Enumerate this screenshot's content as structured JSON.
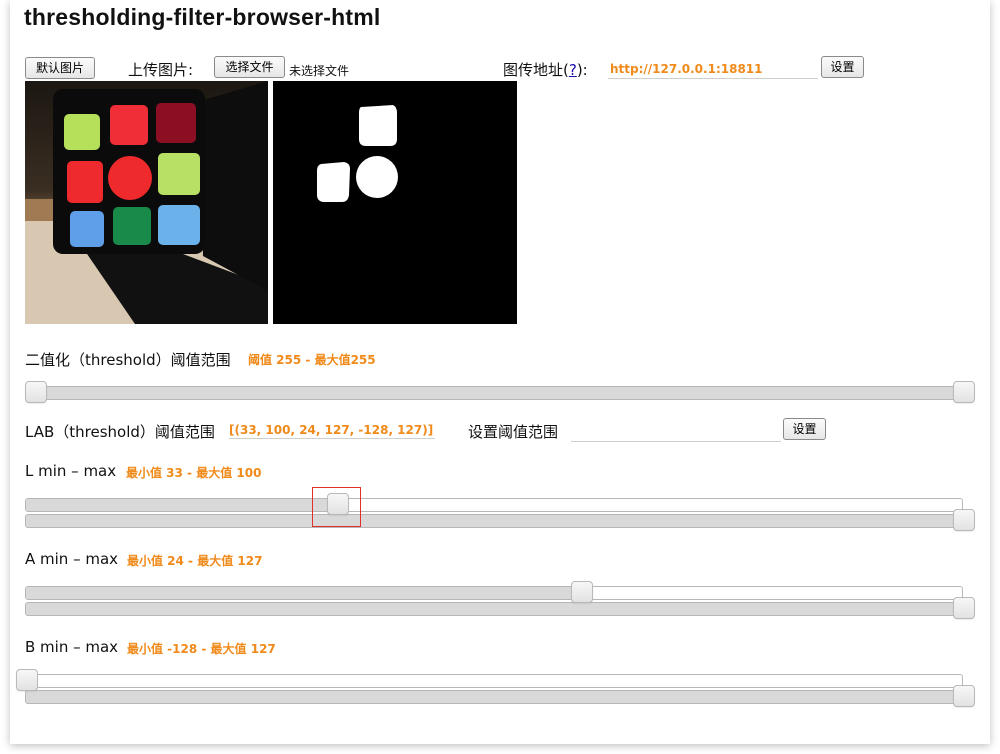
{
  "header": {
    "title": "thresholding-filter-browser-html"
  },
  "controls": {
    "default_image_label": "默认图片",
    "upload_label": "上传图片:",
    "choose_file_label": "选择文件",
    "no_file_label": "未选择文件",
    "image_url_label_prefix": "图传地址(",
    "image_url_help": "?",
    "image_url_label_suffix": "):",
    "image_url_value": "http://127.0.0.1:18811",
    "set_label": "设置"
  },
  "images": {
    "source": "rubiks-cube-photo",
    "mask": "binary-threshold-mask"
  },
  "binary": {
    "label": "二值化（threshold）阈值范围",
    "value_text": "阈值 255 - 最大值255",
    "min": 0,
    "max": 255,
    "range_min": 0,
    "range_max": 255
  },
  "lab": {
    "label": "LAB（threshold）阈值范围",
    "value_text": "[(33, 100, 24, 127, -128, 127)]",
    "set_range_label": "设置阈值范围",
    "set_range_value": "",
    "set_label": "设置"
  },
  "l_slider": {
    "label": "L min – max",
    "value_text": "最小值 33 - 最大值 100",
    "range_min": 0,
    "range_max": 100,
    "min": 33,
    "max": 100
  },
  "a_slider": {
    "label": "A min – max",
    "value_text": "最小值 24 - 最大值 127",
    "range_min": -128,
    "range_max": 127,
    "min": 24,
    "max": 127
  },
  "b_slider": {
    "label": "B min – max",
    "value_text": "最小值 -128 - 最大值 127",
    "range_min": -128,
    "range_max": 127,
    "min": -128,
    "max": 127
  },
  "colors": {
    "accent": "#f08a1a",
    "highlight_box": "#e0302a"
  }
}
